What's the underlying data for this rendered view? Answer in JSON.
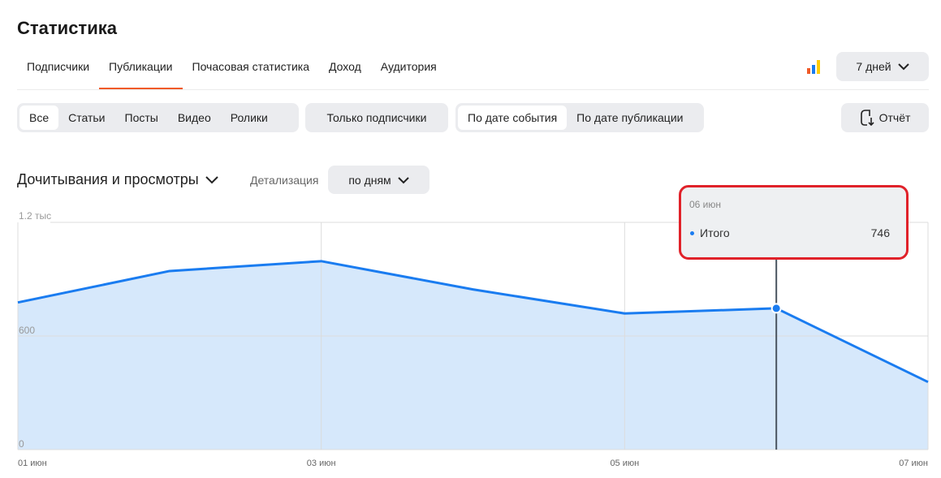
{
  "page_title": "Статистика",
  "main_tabs": [
    {
      "label": "Подписчики"
    },
    {
      "label": "Публикации"
    },
    {
      "label": "Почасовая статистика"
    },
    {
      "label": "Доход"
    },
    {
      "label": "Аудитория"
    }
  ],
  "active_tab_color": "#f05a28",
  "logo_colors": [
    "#f05a28",
    "#1a7cf0",
    "#ffcc00"
  ],
  "period": {
    "label": "7 дней"
  },
  "content_filter": [
    {
      "label": "Все"
    },
    {
      "label": "Статьи"
    },
    {
      "label": "Посты"
    },
    {
      "label": "Видео"
    },
    {
      "label": "Ролики"
    }
  ],
  "subscribers_only": {
    "label": "Только подписчики"
  },
  "date_mode": [
    {
      "label": "По дате события"
    },
    {
      "label": "По дате публикации"
    }
  ],
  "report_button": {
    "label": "Отчёт"
  },
  "metric_select": {
    "label": "Дочитывания и просмотры"
  },
  "detail": {
    "label": "Детализация",
    "value": "по дням"
  },
  "tooltip": {
    "date": "06 июн",
    "series": "Итого",
    "value": "746"
  },
  "chart_data": {
    "type": "area",
    "x": [
      "01 июн",
      "02 июн",
      "03 июн",
      "04 июн",
      "05 июн",
      "06 июн",
      "07 июн"
    ],
    "x_tick_labels": [
      "01 июн",
      "03 июн",
      "05 июн",
      "07 июн"
    ],
    "series": [
      {
        "values": [
          777,
          943,
          995,
          846,
          719,
          746,
          357
        ]
      }
    ],
    "ylim": [
      0,
      1200
    ],
    "y_tick_labels": [
      {
        "value": 0,
        "label": "0"
      },
      {
        "value": 600,
        "label": "600"
      },
      {
        "value": 1200,
        "label": "1.2 тыс"
      }
    ],
    "highlight_index": 5,
    "line_color": "#1a7cf0",
    "fill_color": "#d6e8fb",
    "grid": true
  }
}
